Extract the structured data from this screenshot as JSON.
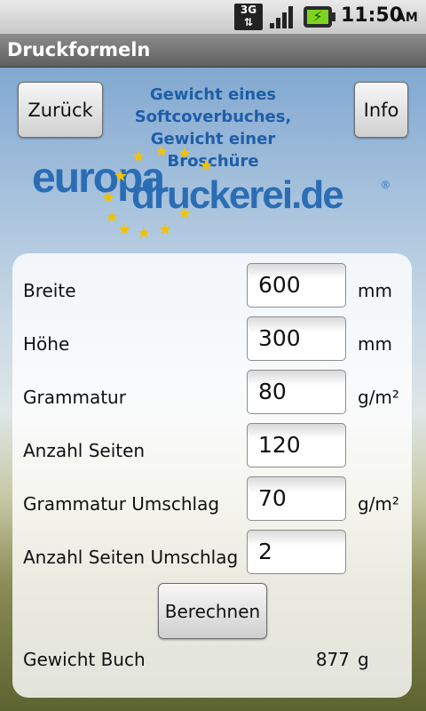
{
  "status_bar": {
    "network": "3G",
    "time": "11:50",
    "ampm": "AM",
    "icons": [
      "3g-data-icon",
      "signal-icon",
      "battery-charging-icon"
    ]
  },
  "title_bar": {
    "title": "Druckformeln"
  },
  "header": {
    "back_label": "Zurück",
    "info_label": "Info",
    "headline": "Gewicht eines Softcoverbuches, Gewicht einer Broschüre",
    "logo": {
      "text_top": "europa",
      "text_bottom": "druckerei.de",
      "mark": "®"
    }
  },
  "form": {
    "rows": [
      {
        "label": "Breite",
        "value": "600",
        "unit": "mm"
      },
      {
        "label": "Höhe",
        "value": "300",
        "unit": "mm"
      },
      {
        "label": "Grammatur",
        "value": "80",
        "unit": "g/m²"
      },
      {
        "label": "Anzahl Seiten",
        "value": "120",
        "unit": ""
      },
      {
        "label": "Grammatur Umschlag",
        "value": "70",
        "unit": "g/m²"
      },
      {
        "label": "Anzahl Seiten Umschlag",
        "value": "2",
        "unit": ""
      }
    ],
    "calculate_label": "Berechnen",
    "result": {
      "label": "Gewicht Buch",
      "value": "877",
      "unit": "g"
    }
  },
  "colors": {
    "headline": "#1e5ea8",
    "logo_blue": "#2a6db5",
    "star_yellow": "#f2c200"
  }
}
